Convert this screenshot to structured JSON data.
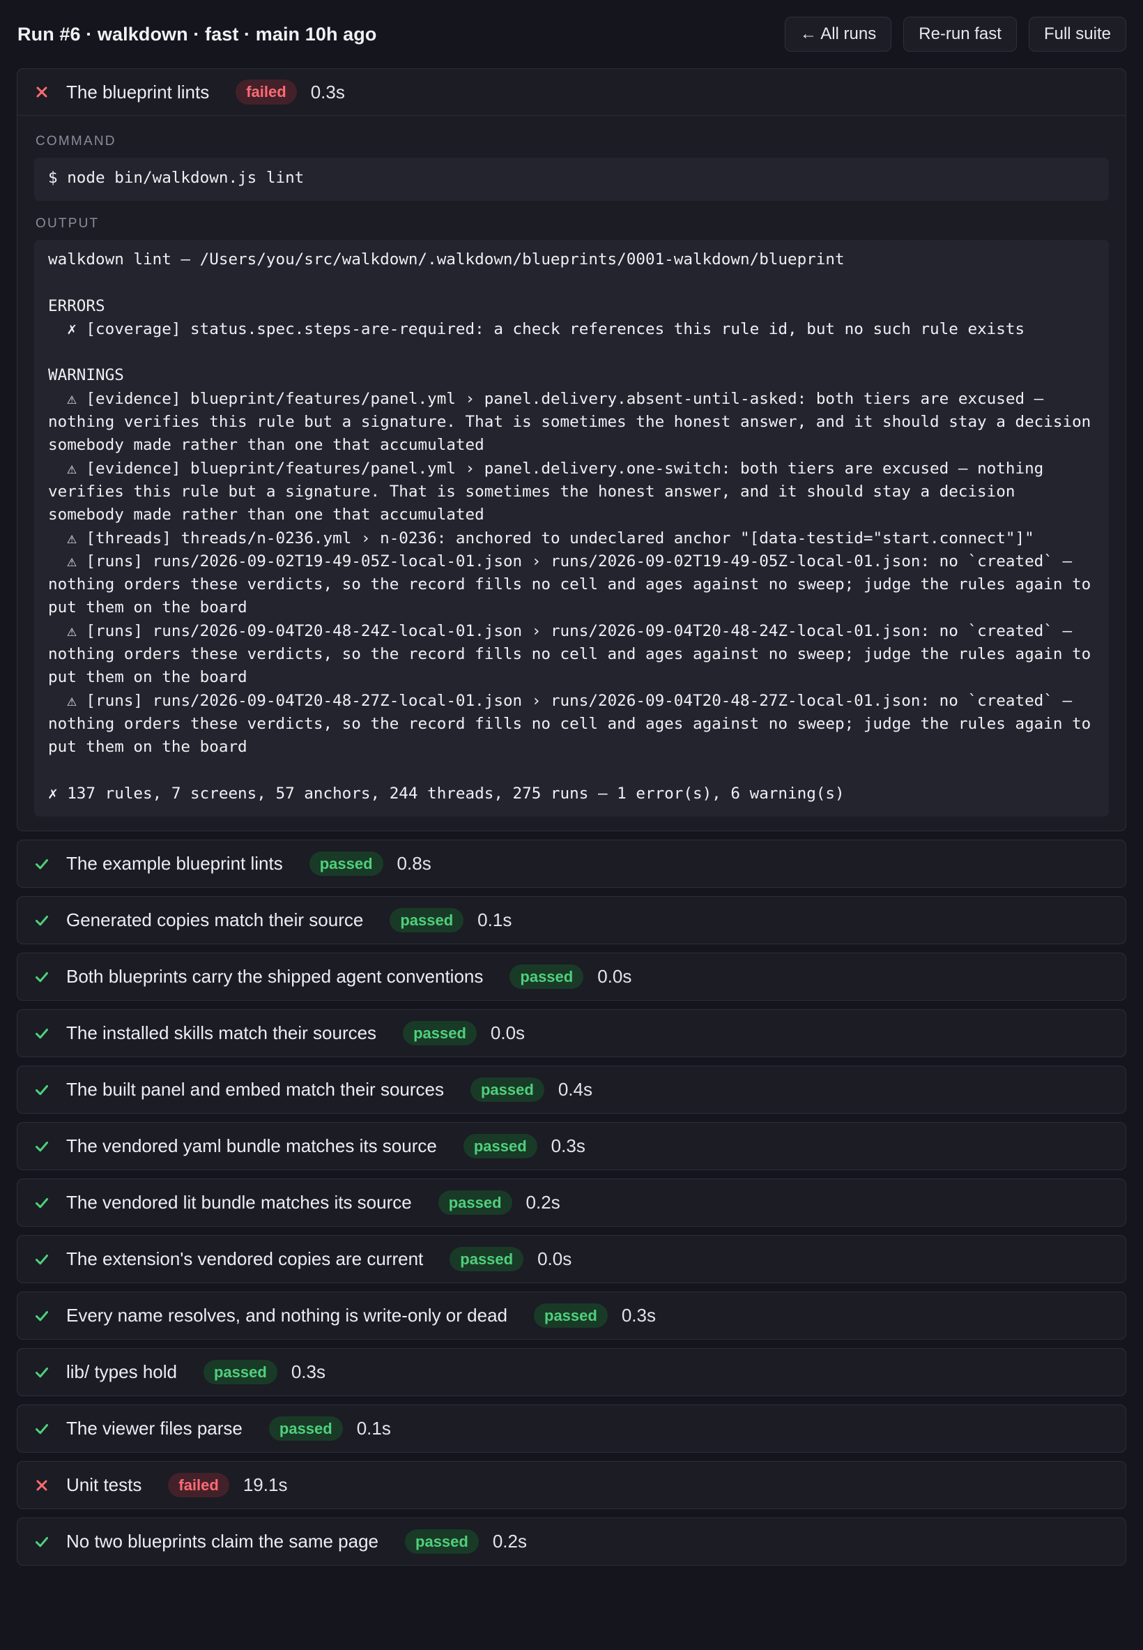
{
  "header": {
    "title": "Run #6 · walkdown · fast · main 10h ago",
    "actions": {
      "all_runs": "← All runs",
      "rerun_fast": "Re-run fast",
      "full_suite": "Full suite"
    }
  },
  "labels": {
    "command": "COMMAND",
    "output": "OUTPUT"
  },
  "colors": {
    "background": "#15161d",
    "card": "#1b1c24",
    "passed": "#4fd07c",
    "failed": "#ff6b72"
  },
  "checks": [
    {
      "name": "The blueprint lints",
      "status": "failed",
      "duration": "0.3s",
      "expanded": true,
      "command": "$ node bin/walkdown.js lint",
      "output": "walkdown lint — /Users/you/src/walkdown/.walkdown/blueprints/0001-walkdown/blueprint\n\nERRORS\n  ✗ [coverage] status.spec.steps-are-required: a check references this rule id, but no such rule exists\n\nWARNINGS\n  ⚠ [evidence] blueprint/features/panel.yml › panel.delivery.absent-until-asked: both tiers are excused — nothing verifies this rule but a signature. That is sometimes the honest answer, and it should stay a decision somebody made rather than one that accumulated\n  ⚠ [evidence] blueprint/features/panel.yml › panel.delivery.one-switch: both tiers are excused — nothing verifies this rule but a signature. That is sometimes the honest answer, and it should stay a decision somebody made rather than one that accumulated\n  ⚠ [threads] threads/n-0236.yml › n-0236: anchored to undeclared anchor \"[data-testid=\"start.connect\"]\"\n  ⚠ [runs] runs/2026-09-02T19-49-05Z-local-01.json › runs/2026-09-02T19-49-05Z-local-01.json: no `created` — nothing orders these verdicts, so the record fills no cell and ages against no sweep; judge the rules again to put them on the board\n  ⚠ [runs] runs/2026-09-04T20-48-24Z-local-01.json › runs/2026-09-04T20-48-24Z-local-01.json: no `created` — nothing orders these verdicts, so the record fills no cell and ages against no sweep; judge the rules again to put them on the board\n  ⚠ [runs] runs/2026-09-04T20-48-27Z-local-01.json › runs/2026-09-04T20-48-27Z-local-01.json: no `created` — nothing orders these verdicts, so the record fills no cell and ages against no sweep; judge the rules again to put them on the board\n\n✗ 137 rules, 7 screens, 57 anchors, 244 threads, 275 runs — 1 error(s), 6 warning(s)"
    },
    {
      "name": "The example blueprint lints",
      "status": "passed",
      "duration": "0.8s"
    },
    {
      "name": "Generated copies match their source",
      "status": "passed",
      "duration": "0.1s"
    },
    {
      "name": "Both blueprints carry the shipped agent conventions",
      "status": "passed",
      "duration": "0.0s"
    },
    {
      "name": "The installed skills match their sources",
      "status": "passed",
      "duration": "0.0s"
    },
    {
      "name": "The built panel and embed match their sources",
      "status": "passed",
      "duration": "0.4s"
    },
    {
      "name": "The vendored yaml bundle matches its source",
      "status": "passed",
      "duration": "0.3s"
    },
    {
      "name": "The vendored lit bundle matches its source",
      "status": "passed",
      "duration": "0.2s"
    },
    {
      "name": "The extension's vendored copies are current",
      "status": "passed",
      "duration": "0.0s"
    },
    {
      "name": "Every name resolves, and nothing is write-only or dead",
      "status": "passed",
      "duration": "0.3s"
    },
    {
      "name": "lib/ types hold",
      "status": "passed",
      "duration": "0.3s"
    },
    {
      "name": "The viewer files parse",
      "status": "passed",
      "duration": "0.1s"
    },
    {
      "name": "Unit tests",
      "status": "failed",
      "duration": "19.1s"
    },
    {
      "name": "No two blueprints claim the same page",
      "status": "passed",
      "duration": "0.2s"
    }
  ]
}
